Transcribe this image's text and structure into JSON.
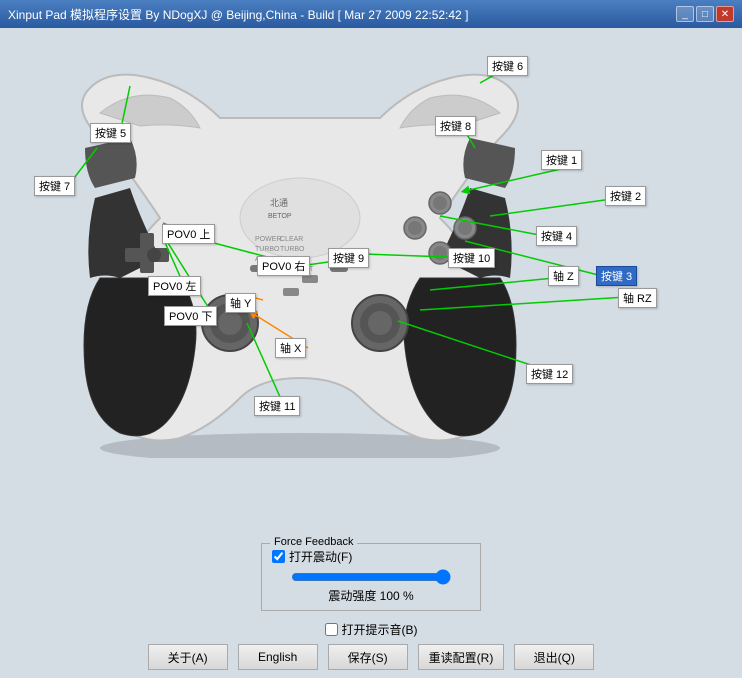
{
  "titlebar": {
    "text": "Xinput Pad 模拟程序设置 By NDogXJ @ Beijing,China - Build [ Mar 27 2009 22:52:42 ]"
  },
  "labels": {
    "btn1": "按键 1",
    "btn2": "按键 2",
    "btn3": "按键 3",
    "btn4": "按键 4",
    "btn5": "按键 5",
    "btn6": "按键 6",
    "btn7": "按键 7",
    "btn8": "按键 8",
    "btn9": "按键 9",
    "btn10": "按键 10",
    "btn11": "按键 11",
    "btn12": "按键 12",
    "pov_up": "POV0 上",
    "pov_down": "POV0 下",
    "pov_left": "POV0 左",
    "pov_right": "POV0 右",
    "axis_x": "轴 X",
    "axis_y": "轴 Y",
    "axis_z": "轴 Z",
    "axis_rz": "轴 RZ"
  },
  "force_feedback": {
    "group_title": "Force Feedback",
    "vibration_label": "打开震动(F)",
    "vibration_checked": true,
    "volume_label": "震动强度 100 %"
  },
  "sound": {
    "label": "打开提示音(B)",
    "checked": false
  },
  "buttons": {
    "about": "关于(A)",
    "english": "English",
    "save": "保存(S)",
    "reload": "重读配置(R)",
    "exit": "退出(Q)"
  }
}
